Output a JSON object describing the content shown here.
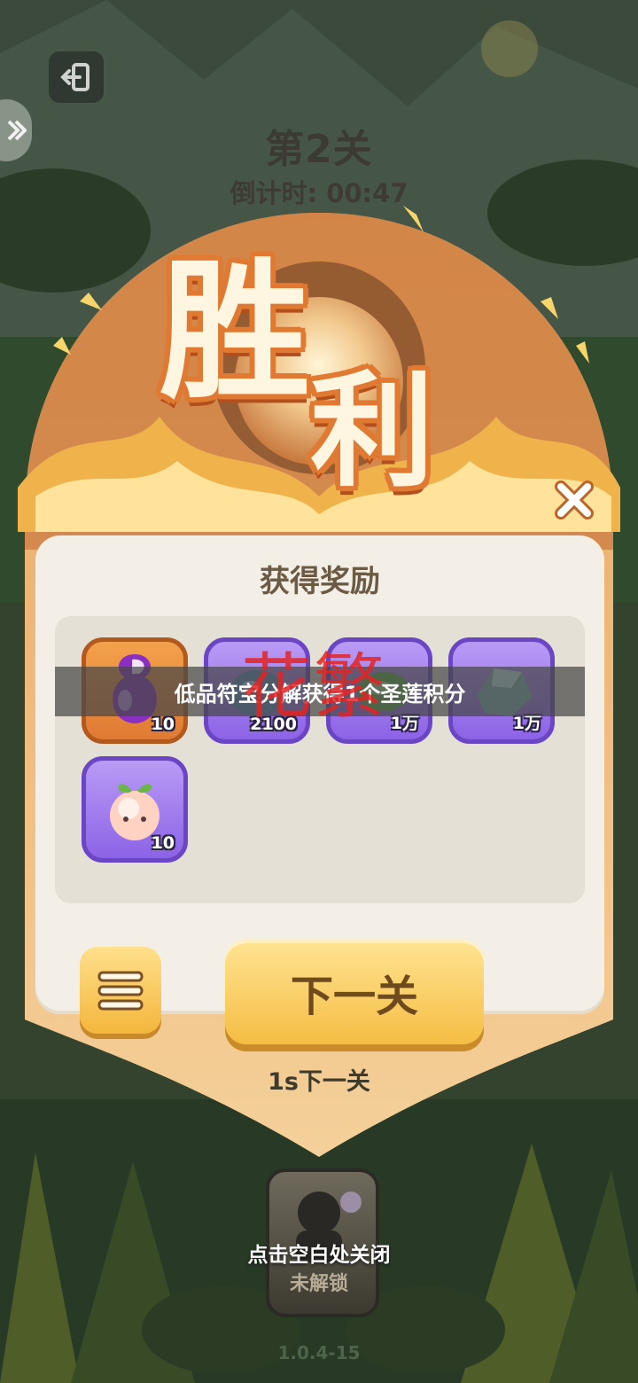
{
  "level_title": "第2关",
  "countdown": {
    "label": "倒计时:",
    "time": "00:47"
  },
  "victory": {
    "char1": "胜",
    "char2": "利"
  },
  "rewards": {
    "title": "获得奖励",
    "items": [
      {
        "name": "purple-gourd",
        "count": "10"
      },
      {
        "name": "blue-orb",
        "count": "2100"
      },
      {
        "name": "green-leaf",
        "count": "1万"
      },
      {
        "name": "crystal-stone",
        "count": "1万"
      },
      {
        "name": "peach-sprout",
        "count": "10"
      }
    ]
  },
  "toast": "低品符宝分解获得1个圣莲积分",
  "overlay_mark": "花繁",
  "buttons": {
    "next": "下一关"
  },
  "auto_next": "1s下一关",
  "locked_card": {
    "label": "未解锁"
  },
  "close_hint": "点击空白处关闭",
  "version": "1.0.4-15",
  "colors": {
    "accent_orange": "#e07a33",
    "panel": "#f3efe6",
    "button_gold": "#f5bd43",
    "slot_purple": "#8c63e6"
  }
}
